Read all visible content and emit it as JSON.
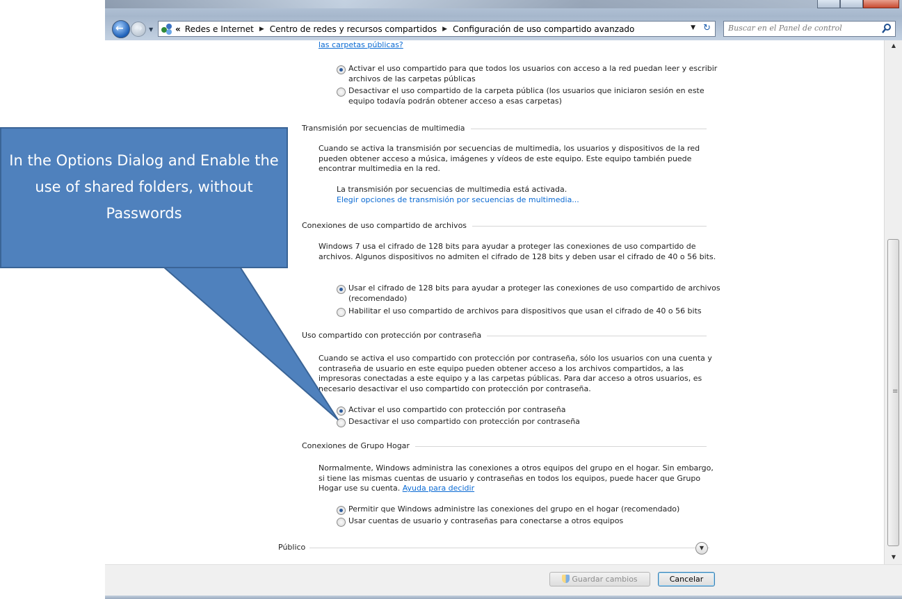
{
  "breadcrumb": {
    "root": "«",
    "items": [
      "Redes e Internet",
      "Centro de redes y recursos compartidos",
      "Configuración de uso compartido avanzado"
    ]
  },
  "search": {
    "placeholder": "Buscar en el Panel de control"
  },
  "content": {
    "top_link": "las carpetas públicas?",
    "public_folder_options": [
      "Activar el uso compartido para que todos los usuarios con acceso a la red puedan leer y escribir archivos de las carpetas públicas",
      "Desactivar el uso compartido de la carpeta pública (los usuarios que iniciaron sesión en este equipo todavía podrán obtener acceso a esas carpetas)"
    ],
    "media_section": {
      "title": "Transmisión por secuencias de multimedia",
      "description": "Cuando se activa la transmisión por secuencias de multimedia, los usuarios y dispositivos de la red pueden obtener acceso a música, imágenes y vídeos de este equipo. Este equipo también puede encontrar multimedia en la red.",
      "status": "La transmisión por secuencias de multimedia está activada.",
      "link": "Elegir opciones de transmisión por secuencias de multimedia..."
    },
    "file_sharing_section": {
      "title": "Conexiones de uso compartido de archivos",
      "description": "Windows 7 usa el cifrado de 128 bits para ayudar a proteger las conexiones de uso compartido de archivos. Algunos dispositivos no admiten el cifrado de 128 bits y deben usar el cifrado de 40 o 56 bits.",
      "options": [
        "Usar el cifrado de 128 bits para ayudar a proteger las conexiones de uso compartido de archivos (recomendado)",
        "Habilitar el uso compartido de archivos para dispositivos que usan el cifrado de 40 o 56 bits"
      ]
    },
    "password_section": {
      "title": "Uso compartido con protección por contraseña",
      "description": "Cuando se activa el uso compartido con protección por contraseña, sólo los usuarios con una cuenta y contraseña de usuario en este equipo pueden obtener acceso a los archivos compartidos, a las impresoras conectadas a este equipo y a las carpetas públicas. Para dar acceso a otros usuarios, es necesario desactivar el uso compartido con protección por contraseña.",
      "options": [
        "Activar el uso compartido con protección por contraseña",
        "Desactivar el uso compartido con protección por contraseña"
      ]
    },
    "homegroup_section": {
      "title": "Conexiones de Grupo Hogar",
      "description": "Normalmente, Windows administra las conexiones a otros equipos del grupo en el hogar. Sin embargo, si tiene las mismas cuentas de usuario y contraseñas en todos los equipos, puede hacer que Grupo Hogar use su cuenta.",
      "help_link": "Ayuda para decidir",
      "options": [
        "Permitir que Windows administre las conexiones del grupo en el hogar (recomendado)",
        "Usar cuentas de usuario y contraseñas para conectarse a otros equipos"
      ]
    },
    "public_profile": {
      "title": "Público"
    }
  },
  "footer": {
    "save_label": "Guardar cambios",
    "cancel_label": "Cancelar"
  },
  "callout": {
    "text": "In the Options Dialog and Enable the use of shared folders, without Passwords",
    "color": "#4f81bd"
  }
}
